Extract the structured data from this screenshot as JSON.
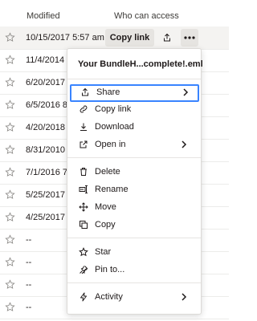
{
  "header": {
    "modified": "Modified",
    "access": "Who can access"
  },
  "rows": [
    {
      "date": "10/15/2017 5:57 am"
    },
    {
      "date": "11/4/2014 1"
    },
    {
      "date": "6/20/2017"
    },
    {
      "date": "6/5/2016 8"
    },
    {
      "date": "4/20/2018"
    },
    {
      "date": "8/31/2010"
    },
    {
      "date": "7/1/2016 7:"
    },
    {
      "date": "5/25/2017"
    },
    {
      "date": "4/25/2017"
    },
    {
      "date": "--"
    },
    {
      "date": "--"
    },
    {
      "date": "--"
    },
    {
      "date": "--"
    }
  ],
  "row_actions": {
    "copy_link": "Copy link"
  },
  "menu": {
    "title": "Your BundleH...complete!.eml",
    "items": [
      {
        "label": "Share",
        "icon": "share-icon"
      },
      {
        "label": "Copy link",
        "icon": "link-icon"
      },
      {
        "label": "Download",
        "icon": "download-icon"
      },
      {
        "label": "Open in",
        "icon": "open-external-icon"
      },
      {
        "label": "Delete",
        "icon": "trash-icon"
      },
      {
        "label": "Rename",
        "icon": "rename-icon"
      },
      {
        "label": "Move",
        "icon": "move-icon"
      },
      {
        "label": "Copy",
        "icon": "copy-icon"
      },
      {
        "label": "Star",
        "icon": "star-icon"
      },
      {
        "label": "Pin to...",
        "icon": "pin-icon"
      },
      {
        "label": "Activity",
        "icon": "activity-icon"
      }
    ]
  },
  "colors": {
    "focus": "#3984ff",
    "row_active": "#f4f3f1",
    "button_bg": "#e6e4e1"
  }
}
